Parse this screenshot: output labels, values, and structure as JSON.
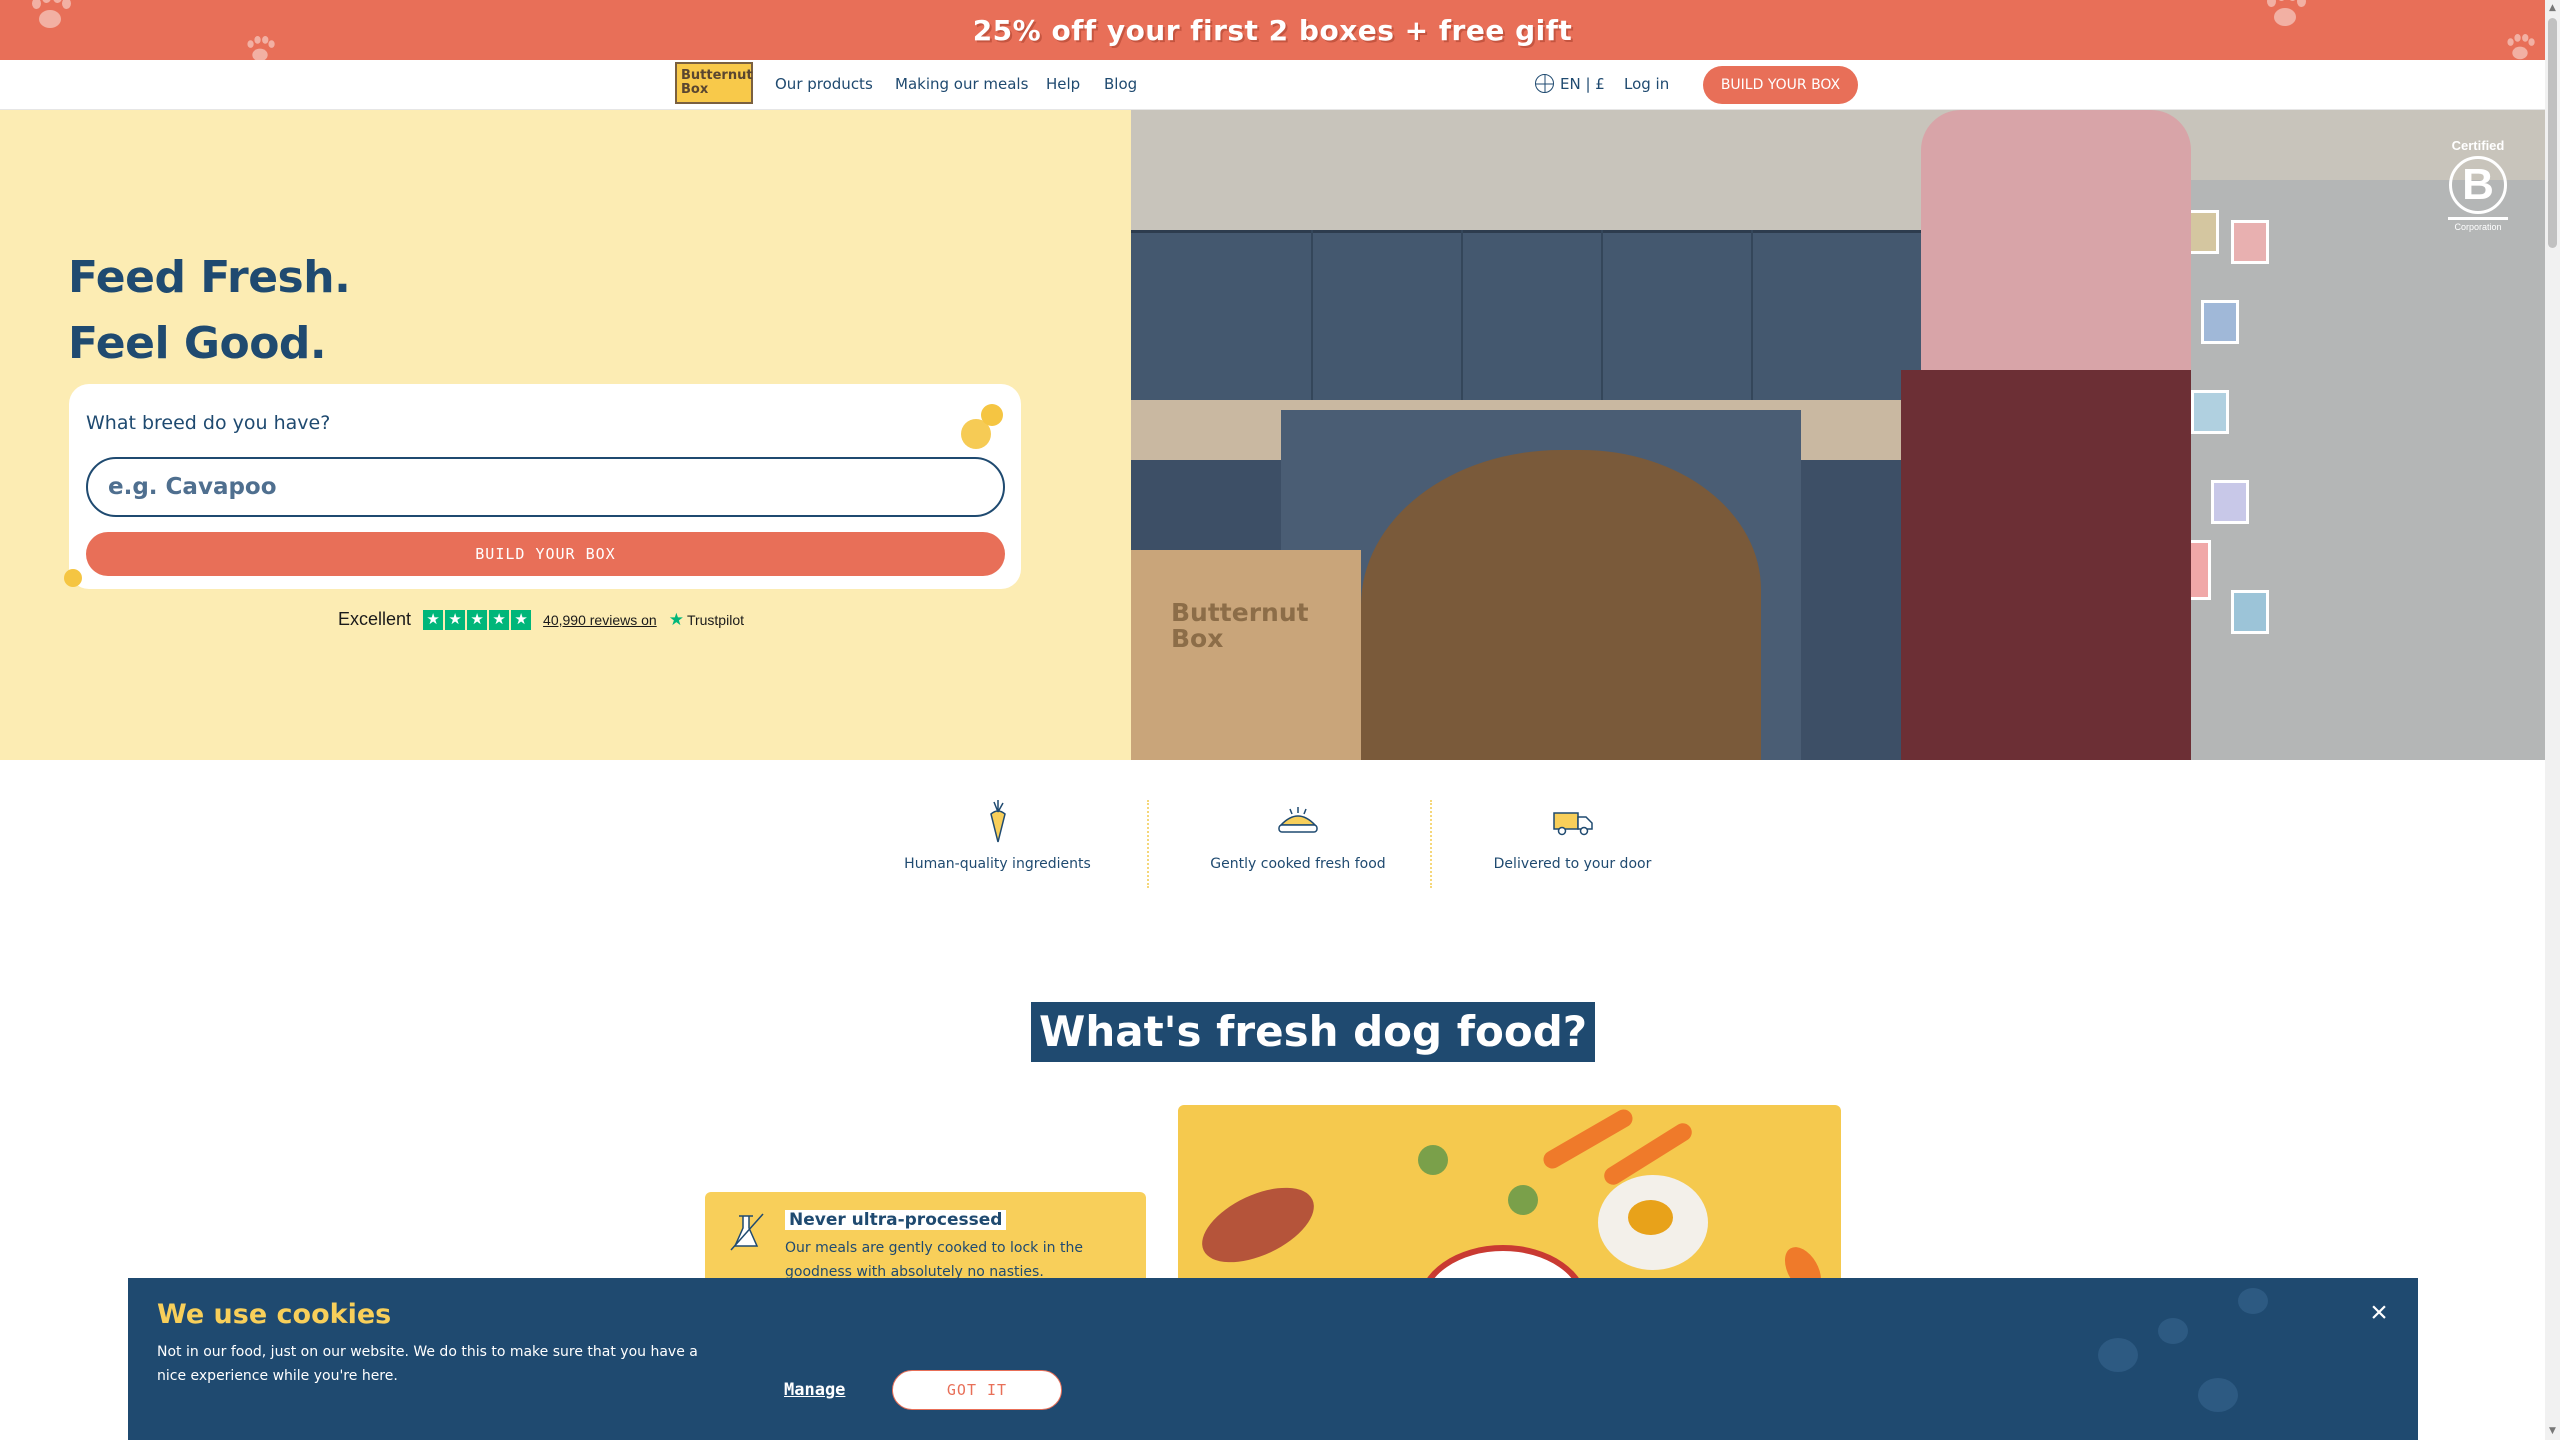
{
  "promo": {
    "text": "25% off your first 2 boxes + free gift"
  },
  "nav": {
    "logo_text": "Butternut Box",
    "links": [
      {
        "label": "Our products"
      },
      {
        "label": "Making our meals"
      },
      {
        "label": "Help"
      },
      {
        "label": "Blog"
      }
    ],
    "language": "EN | £",
    "login": "Log in",
    "cta": "BUILD YOUR BOX"
  },
  "hero": {
    "title_line1": "Feed Fresh.",
    "title_line2": "Feel Good.",
    "breed_label": "What breed do you have?",
    "breed_placeholder": "e.g. Cavapoo",
    "cta": "BUILD YOUR BOX",
    "trustpilot": {
      "rating_text": "Excellent",
      "stars": 5,
      "reviews": "40,990 reviews on",
      "brand": "Trustpilot"
    },
    "box_text": "Butternut Box",
    "bcorp": {
      "certified": "Certified",
      "letter": "B",
      "corporation": "Corporation"
    }
  },
  "features": [
    {
      "label": "Human-quality ingredients",
      "icon": "carrot-icon"
    },
    {
      "label": "Gently cooked fresh food",
      "icon": "food-bowl-icon"
    },
    {
      "label": "Delivered to your door",
      "icon": "delivery-van-icon"
    }
  ],
  "section": {
    "title": "What's fresh dog food?",
    "fact": {
      "title": "Never ultra-processed",
      "body": "Our meals are gently cooked to lock in the goodness with absolutely no nasties."
    }
  },
  "cookie": {
    "title": "We use cookies",
    "body": "Not in our food, just on our website. We do this to make sure that you have a nice experience while you're here.",
    "manage": "Manage",
    "accept": "GOT IT",
    "close": "×"
  },
  "colors": {
    "brand_red": "#e86f58",
    "navy": "#1f4a70",
    "cream": "#fcecb3",
    "yellow": "#f8cf5a",
    "trustpilot_green": "#00b67a"
  }
}
